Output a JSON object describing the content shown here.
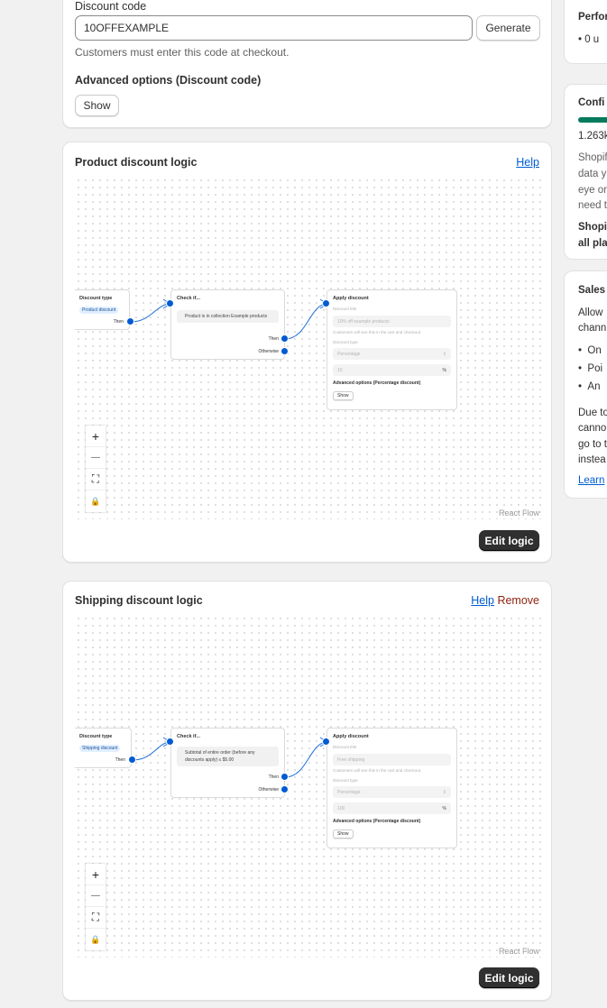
{
  "discount_code": {
    "label": "Discount code",
    "value": "10OFFEXAMPLE",
    "generate_label": "Generate",
    "help": "Customers must enter this code at checkout.",
    "advanced_title": "Advanced options (Discount code)",
    "show_label": "Show"
  },
  "product_logic": {
    "title": "Product discount logic",
    "help_label": "Help",
    "trigger": {
      "title": "Discount type",
      "pill": "Product discount",
      "then": "Then"
    },
    "condition": {
      "title": "Check if...",
      "text": "Product is in collection Example products",
      "then": "Then",
      "otherwise": "Otherwise"
    },
    "action": {
      "title": "Apply discount",
      "title_label": "Discount title",
      "title_placeholder": "10% off example products",
      "help": "Customers will see this in the cart and checkout.",
      "type_label": "Discount type",
      "type_value": "Percentage",
      "amount": "10",
      "unit": "%",
      "advanced": "Advanced options (Percentage discount)",
      "show": "Show"
    },
    "attribution": "React Flow",
    "edit_label": "Edit logic"
  },
  "shipping_logic": {
    "title": "Shipping discount logic",
    "help_label": "Help",
    "remove_label": "Remove",
    "trigger": {
      "title": "Discount type",
      "pill": "Shipping discount",
      "then": "Then"
    },
    "condition": {
      "title": "Check if...",
      "text": "Subtotal of entire order (before any discounts apply) ≤ $5.00",
      "then": "Then",
      "otherwise": "Otherwise"
    },
    "action": {
      "title": "Apply discount",
      "title_label": "Discount title",
      "title_placeholder": "Free shipping",
      "help": "Customers will see this in the cart and checkout.",
      "type_label": "Discount type",
      "type_value": "Percentage",
      "amount": "100",
      "unit": "%",
      "advanced": "Advanced options (Percentage discount)",
      "show": "Show"
    },
    "attribution": "React Flow",
    "edit_label": "Edit logic"
  },
  "controls": {
    "zoom_in": "+",
    "zoom_out": "—",
    "fit": "⛶",
    "lock": "🔒"
  },
  "sidebar": {
    "perf_title": "Perfor",
    "perf_item": "• 0 u",
    "confi_title": "Confi",
    "confi_value": "1.263k",
    "confi_lines": [
      "Shopif",
      "data y",
      "eye or",
      "need t"
    ],
    "confi_bold": [
      "Shopi",
      "all pla"
    ],
    "sales_title": "Sales",
    "sales_lines": [
      "Allow",
      "chann"
    ],
    "sales_items": [
      "On",
      "Poi",
      "An"
    ],
    "sales_lines2": [
      "Due to",
      "canno",
      "go to t",
      "instea"
    ],
    "learn": "Learn"
  },
  "colors": {
    "accent": "#005bd3",
    "progress": "#047b5d",
    "remove": "#8e1f0b"
  }
}
